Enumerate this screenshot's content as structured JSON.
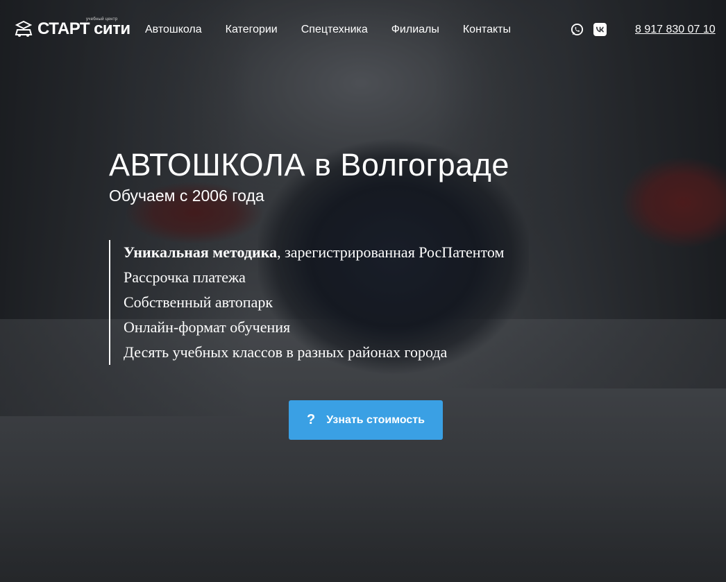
{
  "header": {
    "logo": {
      "word1": "СТАРТ",
      "word2": "сити",
      "tagline": "учебный центр"
    },
    "nav": [
      {
        "label": "Автошкола"
      },
      {
        "label": "Категории"
      },
      {
        "label": "Спецтехника"
      },
      {
        "label": "Филиалы"
      },
      {
        "label": "Контакты"
      }
    ],
    "socials": [
      {
        "icon": "whatsapp-icon"
      },
      {
        "icon": "vk-icon"
      }
    ],
    "phone": "8 917 830 07 10"
  },
  "hero": {
    "title": "АВТОШКОЛА в Волгограде",
    "subtitle": "Обучаем с 2006 года",
    "features": [
      {
        "bold": "Уникальная методика",
        "rest": ", зарегистрированная РосПатентом"
      },
      {
        "bold": "",
        "rest": "Рассрочка платежа"
      },
      {
        "bold": "",
        "rest": "Собственный автопарк"
      },
      {
        "bold": "",
        "rest": "Онлайн-формат обучения"
      },
      {
        "bold": "",
        "rest": "Десять учебных классов в разных районах города"
      }
    ],
    "cta": {
      "icon_glyph": "?",
      "label": "Узнать стоимость"
    }
  },
  "colors": {
    "accent": "#3aa0e4",
    "text": "#ffffff"
  }
}
